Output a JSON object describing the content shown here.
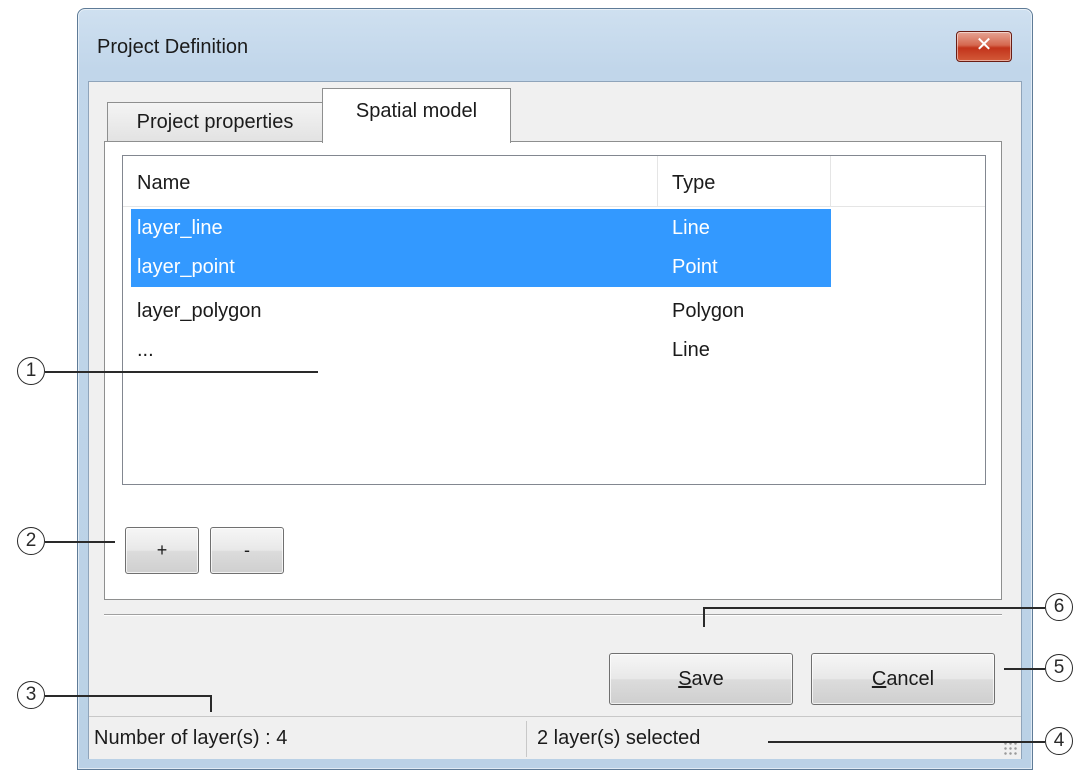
{
  "window": {
    "title": "Project Definition",
    "close_label": "✕"
  },
  "tabs": [
    {
      "label": "Project properties",
      "active": false
    },
    {
      "label": "Spatial model",
      "active": true
    }
  ],
  "layer_list": {
    "columns": [
      "Name",
      "Type",
      ""
    ],
    "rows": [
      {
        "name": "layer_line",
        "type": "Line",
        "selected": true
      },
      {
        "name": "layer_point",
        "type": "Point",
        "selected": true
      },
      {
        "name": "layer_polygon",
        "type": "Polygon",
        "selected": false
      },
      {
        "name": "...",
        "type": "Line",
        "selected": false
      }
    ]
  },
  "layer_buttons": {
    "add_label": "+",
    "remove_label": "-"
  },
  "actions": {
    "save_mnemonic": "S",
    "save_rest": "ave",
    "cancel_mnemonic": "C",
    "cancel_rest": "ancel"
  },
  "status": {
    "layer_count": "Number of layer(s) : 4",
    "selection": "2 layer(s) selected"
  },
  "callouts": [
    "1",
    "2",
    "3",
    "4",
    "5",
    "6"
  ],
  "colors": {
    "selection": "#3399ff",
    "window_frame": "#c1d6ea",
    "close_button": "#c2341b"
  }
}
